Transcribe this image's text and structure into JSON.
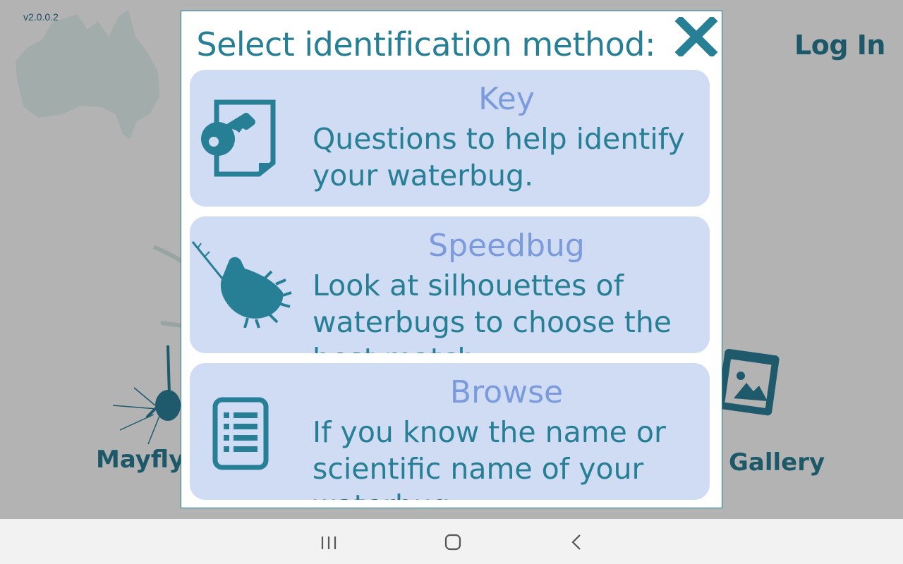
{
  "app": {
    "version": "v2.0.0.2",
    "login_label": "Log In",
    "bottom_labels": {
      "mayfly": "Mayfly",
      "gallery": "Gallery"
    }
  },
  "dialog": {
    "title": "Select identification method:",
    "close_icon": "close-x-icon",
    "options": [
      {
        "title": "Key",
        "description": "Questions to help identify your waterbug.",
        "icon": "key-document-icon"
      },
      {
        "title": "Speedbug",
        "description": "Look at silhouettes of waterbugs to choose the best match.",
        "icon": "waterbug-silhouette-icon"
      },
      {
        "title": "Browse",
        "description": "If you know the name or scientific name of your waterbug.",
        "icon": "list-document-icon"
      }
    ]
  },
  "nav_bar": {
    "buttons": [
      "recent-apps",
      "home",
      "back"
    ]
  },
  "colors": {
    "accent": "#267f95",
    "card_background": "#d0dcf3",
    "card_title": "#7b9bdc",
    "overlay": "#b3b3b3"
  }
}
